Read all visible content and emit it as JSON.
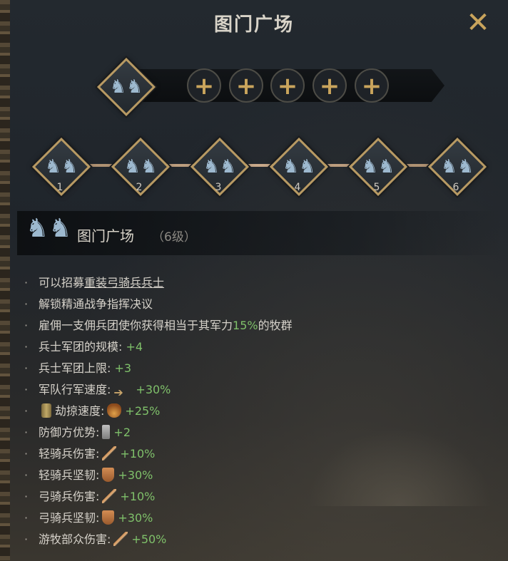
{
  "title": "图门广场",
  "close_icon": "✕",
  "unit_glyph": "♞♞",
  "slots": {
    "add_label": "+",
    "count": 5
  },
  "levels": [
    "1",
    "2",
    "3",
    "4",
    "5",
    "6"
  ],
  "info": {
    "name": "图门广场",
    "level": "（6级）"
  },
  "effects": [
    {
      "text": "可以招募",
      "link": "重装弓骑兵兵士"
    },
    {
      "text": "解锁精通战争指挥决议"
    },
    {
      "pre": "雇佣一支佣兵团使你获得相当于其军力",
      "value": "15%",
      "post": "的牧群"
    },
    {
      "label": "兵士军团的规模:",
      "value": "+4"
    },
    {
      "label": "兵士军团上限:",
      "value": "+3"
    },
    {
      "label": "军队行军速度:",
      "icon": "arrow-icon",
      "value": "+30%"
    },
    {
      "label": "劫掠速度:",
      "icon": "fire-icon",
      "value": "+25%",
      "lead_icon": "scroll-icon"
    },
    {
      "label": "防御方优势:",
      "icon": "tower-icon",
      "value": "+2"
    },
    {
      "label": "轻骑兵伤害:",
      "icon": "sword-icon",
      "value": "+10%"
    },
    {
      "label": "轻骑兵坚韧:",
      "icon": "shield-icon",
      "value": "+30%"
    },
    {
      "label": "弓骑兵伤害:",
      "icon": "sword-icon",
      "value": "+10%"
    },
    {
      "label": "弓骑兵坚韧:",
      "icon": "shield-icon",
      "value": "+30%"
    },
    {
      "label": "游牧部众伤害:",
      "icon": "sword-icon",
      "value": "+50%"
    }
  ],
  "colors": {
    "accent_gold": "#c9a45c",
    "positive": "#7fc06a",
    "unit_blue": "#9db9cf"
  }
}
